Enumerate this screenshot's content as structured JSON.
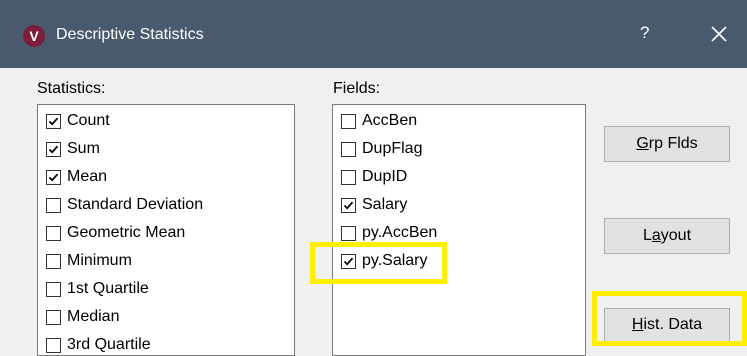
{
  "window": {
    "app_icon_letter": "V",
    "title": "Descriptive Statistics",
    "help_label": "?"
  },
  "statistics": {
    "label": "Statistics:",
    "items": [
      {
        "label": "Count",
        "checked": true
      },
      {
        "label": "Sum",
        "checked": true
      },
      {
        "label": "Mean",
        "checked": true
      },
      {
        "label": "Standard Deviation",
        "checked": false
      },
      {
        "label": "Geometric Mean",
        "checked": false
      },
      {
        "label": "Minimum",
        "checked": false
      },
      {
        "label": "1st Quartile",
        "checked": false
      },
      {
        "label": "Median",
        "checked": false
      },
      {
        "label": "3rd Quartile",
        "checked": false
      }
    ]
  },
  "fields": {
    "label": "Fields:",
    "items": [
      {
        "label": "AccBen",
        "checked": false
      },
      {
        "label": "DupFlag",
        "checked": false
      },
      {
        "label": "DupID",
        "checked": false
      },
      {
        "label": "Salary",
        "checked": true
      },
      {
        "label": "py.AccBen",
        "checked": false
      },
      {
        "label": "py.Salary",
        "checked": true
      }
    ]
  },
  "buttons": {
    "grp_flds": {
      "mnemonic": "G",
      "rest": "rp Flds"
    },
    "layout": {
      "before": "L",
      "mnemonic": "a",
      "rest": "yout"
    },
    "hist_data": {
      "mnemonic": "H",
      "rest": "ist. Data"
    }
  },
  "colors": {
    "titlebar": "#4a5a6e",
    "highlight": "#ffee00",
    "app_icon": "#7b1e3a"
  }
}
